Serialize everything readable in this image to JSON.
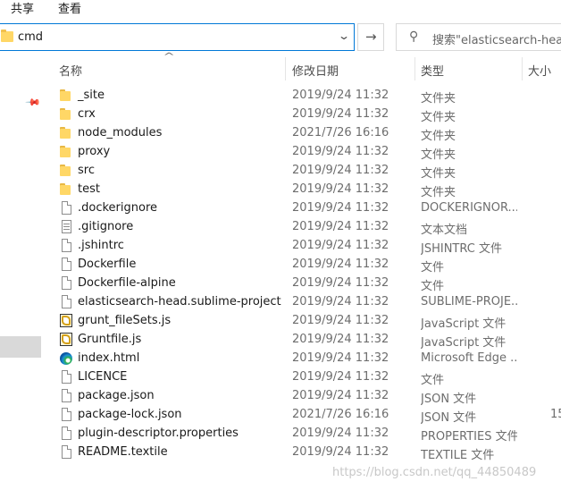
{
  "ribbon": {
    "tabs": [
      "共享",
      "查看"
    ]
  },
  "address": {
    "path": "cmd",
    "folder_icon": "folder-icon"
  },
  "search": {
    "placeholder": "搜索\"elasticsearch-head-m"
  },
  "columns": {
    "name": "名称",
    "date": "修改日期",
    "type": "类型",
    "size": "大小"
  },
  "files": [
    {
      "name": "_site",
      "date": "2019/9/24 11:32",
      "type": "文件夹",
      "size": "",
      "icon": "folder"
    },
    {
      "name": "crx",
      "date": "2019/9/24 11:32",
      "type": "文件夹",
      "size": "",
      "icon": "folder"
    },
    {
      "name": "node_modules",
      "date": "2021/7/26 16:16",
      "type": "文件夹",
      "size": "",
      "icon": "folder"
    },
    {
      "name": "proxy",
      "date": "2019/9/24 11:32",
      "type": "文件夹",
      "size": "",
      "icon": "folder"
    },
    {
      "name": "src",
      "date": "2019/9/24 11:32",
      "type": "文件夹",
      "size": "",
      "icon": "folder"
    },
    {
      "name": "test",
      "date": "2019/9/24 11:32",
      "type": "文件夹",
      "size": "",
      "icon": "folder"
    },
    {
      "name": ".dockerignore",
      "date": "2019/9/24 11:32",
      "type": "DOCKERIGNOR...",
      "size": "",
      "icon": "doc"
    },
    {
      "name": ".gitignore",
      "date": "2019/9/24 11:32",
      "type": "文本文档",
      "size": "",
      "icon": "text"
    },
    {
      "name": ".jshintrc",
      "date": "2019/9/24 11:32",
      "type": "JSHINTRC 文件",
      "size": "",
      "icon": "doc"
    },
    {
      "name": "Dockerfile",
      "date": "2019/9/24 11:32",
      "type": "文件",
      "size": "",
      "icon": "doc"
    },
    {
      "name": "Dockerfile-alpine",
      "date": "2019/9/24 11:32",
      "type": "文件",
      "size": "",
      "icon": "doc"
    },
    {
      "name": "elasticsearch-head.sublime-project",
      "date": "2019/9/24 11:32",
      "type": "SUBLIME-PROJE...",
      "size": "",
      "icon": "doc"
    },
    {
      "name": "grunt_fileSets.js",
      "date": "2019/9/24 11:32",
      "type": "JavaScript 文件",
      "size": "",
      "icon": "js"
    },
    {
      "name": "Gruntfile.js",
      "date": "2019/9/24 11:32",
      "type": "JavaScript 文件",
      "size": "",
      "icon": "js"
    },
    {
      "name": "index.html",
      "date": "2019/9/24 11:32",
      "type": "Microsoft Edge ...",
      "size": "",
      "icon": "edge"
    },
    {
      "name": "LICENCE",
      "date": "2019/9/24 11:32",
      "type": "文件",
      "size": "",
      "icon": "doc"
    },
    {
      "name": "package.json",
      "date": "2019/9/24 11:32",
      "type": "JSON 文件",
      "size": "",
      "icon": "doc"
    },
    {
      "name": "package-lock.json",
      "date": "2021/7/26 16:16",
      "type": "JSON 文件",
      "size": "15",
      "icon": "doc"
    },
    {
      "name": "plugin-descriptor.properties",
      "date": "2019/9/24 11:32",
      "type": "PROPERTIES 文件",
      "size": "",
      "icon": "doc"
    },
    {
      "name": "README.textile",
      "date": "2019/9/24 11:32",
      "type": "TEXTILE 文件",
      "size": "",
      "icon": "doc"
    }
  ],
  "watermark": "https://blog.csdn.net/qq_44850489"
}
